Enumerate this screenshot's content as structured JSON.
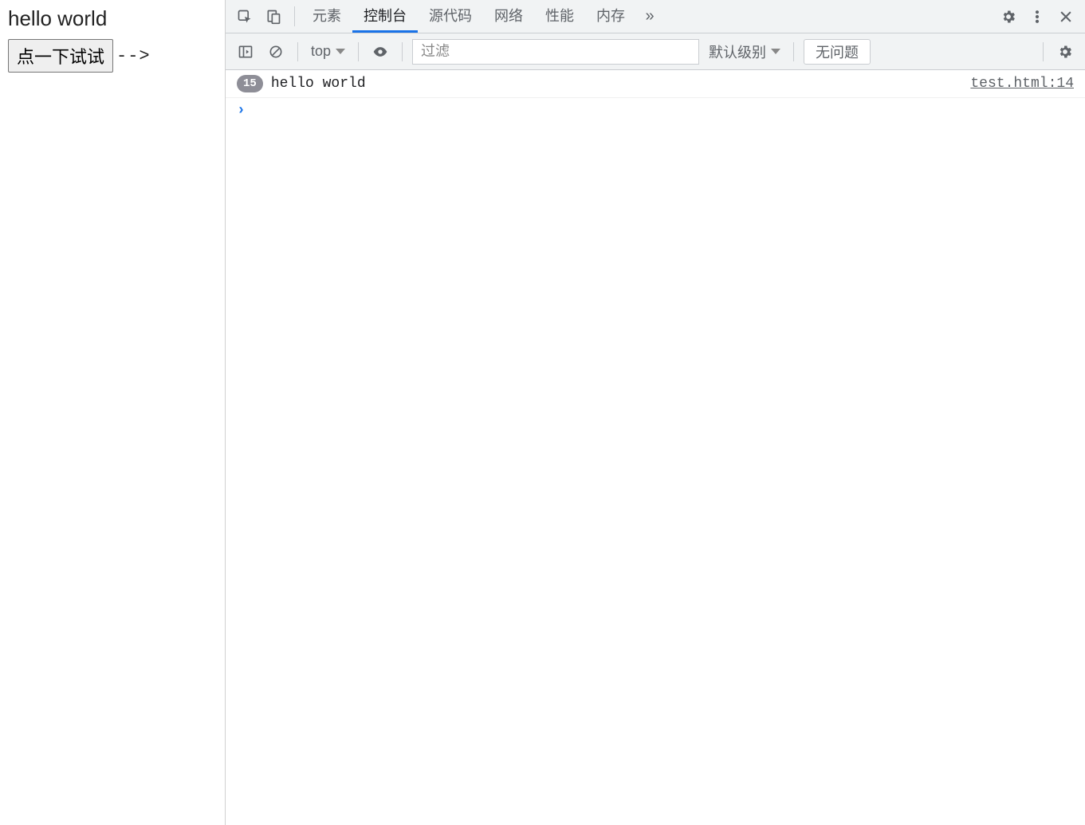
{
  "page": {
    "heading": "hello world",
    "button_label": "点一下试试",
    "arrow_text": "-->"
  },
  "devtools": {
    "tabs": {
      "elements": "元素",
      "console": "控制台",
      "sources": "源代码",
      "network": "网络",
      "performance": "性能",
      "memory": "内存"
    },
    "more_symbol": "»",
    "toolbar": {
      "context_label": "top",
      "filter_placeholder": "过滤",
      "level_label": "默认级别",
      "issues_label": "无问题"
    },
    "log": {
      "count": "15",
      "message": "hello world",
      "source": "test.html:14"
    },
    "prompt_symbol": "›"
  }
}
